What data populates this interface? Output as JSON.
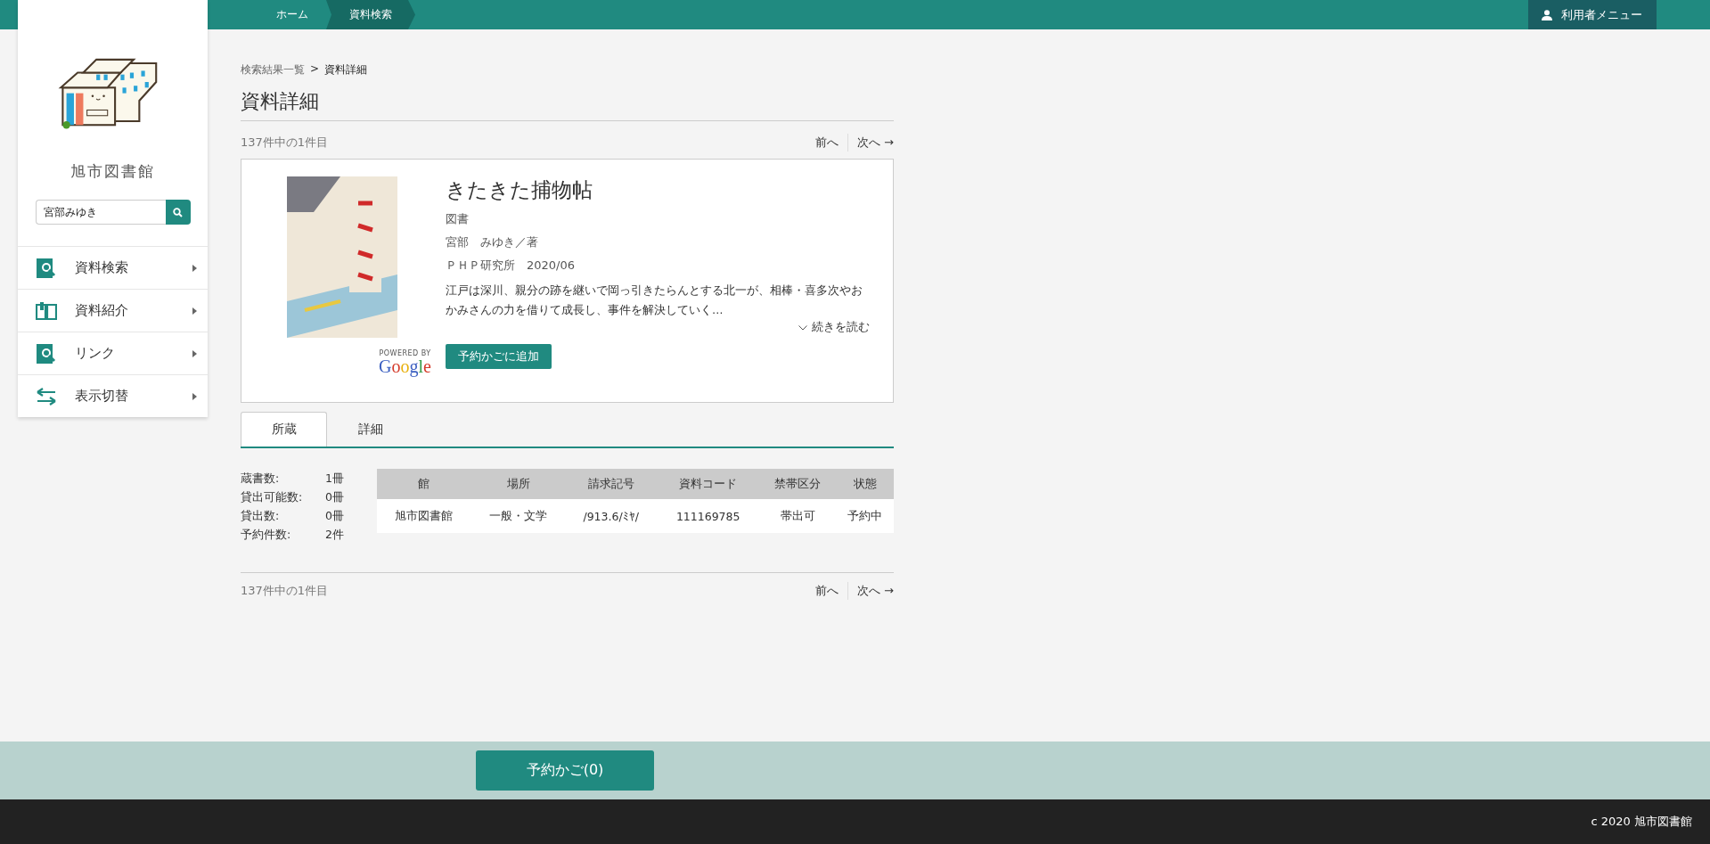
{
  "top_bar": {
    "breadcrumbs": [
      {
        "label": "ホーム",
        "selected": false
      },
      {
        "label": "資料検索",
        "selected": true
      }
    ],
    "user_menu": "利用者メニュー"
  },
  "sidebar": {
    "library_name": "旭市図書館",
    "search": {
      "value": "宮部みゆき"
    },
    "items": [
      {
        "label": "資料検索",
        "kind": "search"
      },
      {
        "label": "資料紹介",
        "kind": "intro"
      },
      {
        "label": "リンク",
        "kind": "search"
      },
      {
        "label": "表示切替",
        "kind": "toggle"
      }
    ]
  },
  "breadcrumb": {
    "parent": "検索結果一覧",
    "separator": ">",
    "current": "資料詳細"
  },
  "page_title": "資料詳細",
  "pager_top": {
    "count": "137件中の1件目",
    "prev": "前へ",
    "next": "次へ →"
  },
  "book": {
    "powered_by": "POWERED BY",
    "google": "Google",
    "title": "きたきた捕物帖",
    "type": "図書",
    "author": "宮部　みゆき／著",
    "publisher": "ＰＨＰ研究所　2020/06",
    "description": "江戸は深川、親分の跡を継いで岡っ引きたらんとする北一が、相棒・喜多次やおかみさんの力を借りて成長し、事件を解決していく…",
    "read_more": "続きを読む",
    "add_button": "予約かごに追加"
  },
  "tabs": [
    {
      "label": "所蔵",
      "selected": true
    },
    {
      "label": "詳細",
      "selected": false
    }
  ],
  "stats": [
    {
      "label": "蔵書数:",
      "value": "1冊"
    },
    {
      "label": "貸出可能数:",
      "value": "0冊"
    },
    {
      "label": "貸出数:",
      "value": "0冊"
    },
    {
      "label": "予約件数:",
      "value": "2件"
    }
  ],
  "table": {
    "columns": [
      "館",
      "場所",
      "請求記号",
      "資料コード",
      "禁帯区分",
      "状態"
    ],
    "rows": [
      [
        "旭市図書館",
        "一般・文学",
        "/913.6/ﾐﾔ/",
        "111169785",
        "帯出可",
        "予約中"
      ]
    ]
  },
  "pager_bottom": {
    "count": "137件中の1件目",
    "prev": "前へ",
    "next": "次へ →"
  },
  "cart_button": "予約かご(0)",
  "footer": "c 2020 旭市図書館"
}
